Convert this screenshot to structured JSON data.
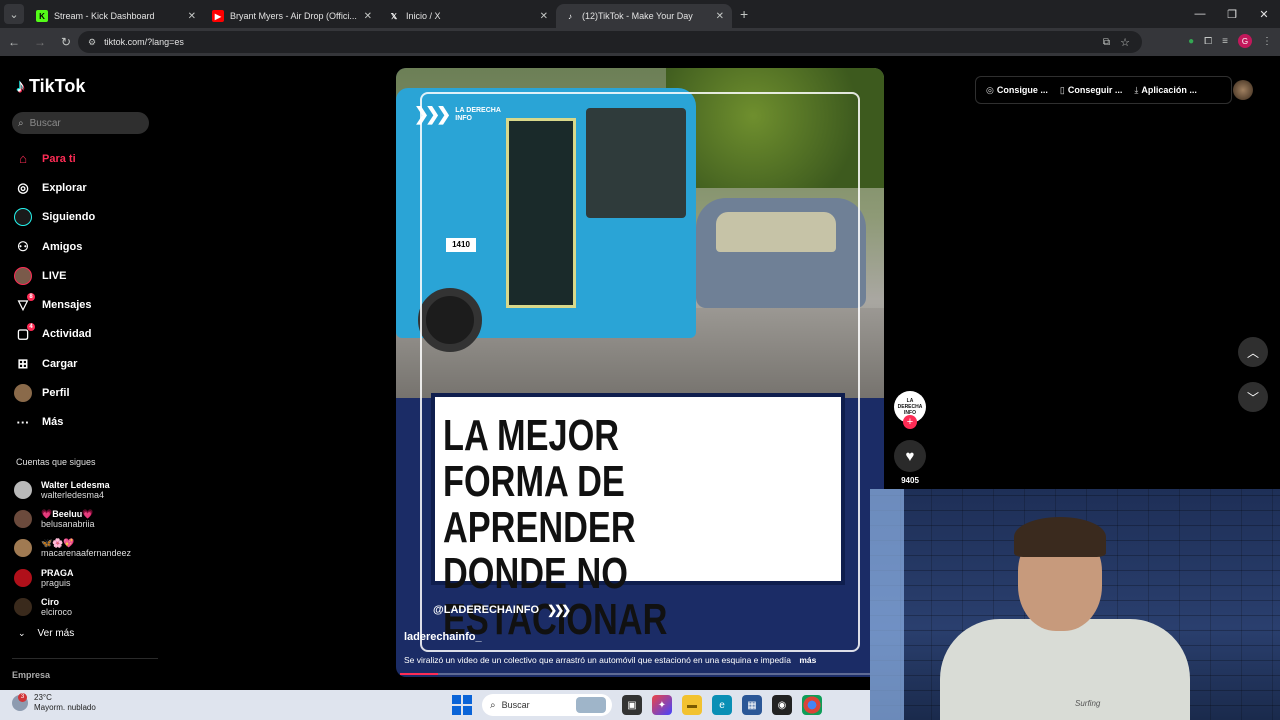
{
  "browser": {
    "tabs": [
      {
        "title": "Stream - Kick Dashboard",
        "icon": "kick-icon",
        "active": false
      },
      {
        "title": "Bryant Myers - Air Drop (Offici...",
        "icon": "youtube-icon",
        "active": false
      },
      {
        "title": "Inicio / X",
        "icon": "x-icon",
        "active": false
      },
      {
        "title": "(12)TikTok - Make Your Day",
        "icon": "tiktok-icon",
        "active": true
      }
    ],
    "url": "tiktok.com/?lang=es",
    "profile_initial": "G"
  },
  "sidebar": {
    "logo_text": "TikTok",
    "search_placeholder": "Buscar",
    "nav": [
      {
        "label": "Para ti",
        "icon": "home-icon",
        "active": true
      },
      {
        "label": "Explorar",
        "icon": "compass-icon"
      },
      {
        "label": "Siguiendo",
        "icon": "following-avatar-icon"
      },
      {
        "label": "Amigos",
        "icon": "friends-icon"
      },
      {
        "label": "LIVE",
        "icon": "live-avatar-icon"
      },
      {
        "label": "Mensajes",
        "icon": "messages-icon",
        "badge": "8"
      },
      {
        "label": "Actividad",
        "icon": "activity-icon",
        "badge": "4"
      },
      {
        "label": "Cargar",
        "icon": "upload-icon"
      },
      {
        "label": "Perfil",
        "icon": "profile-icon"
      },
      {
        "label": "Más",
        "icon": "more-icon"
      }
    ],
    "following_title": "Cuentas que sigues",
    "following": [
      {
        "name": "Walter Ledesma",
        "handle": "walterledesma4",
        "color": "#b9b9b9"
      },
      {
        "name": "💗Beeluu💗",
        "handle": "belusanabriia",
        "color": "#6b4a3c"
      },
      {
        "name": "🦋🌸💖",
        "handle": "macarenaafernandeez",
        "color": "#a07a52"
      },
      {
        "name": "PRAGA",
        "handle": "praguis",
        "color": "#b0101a"
      },
      {
        "name": "Ciro",
        "handle": "elciroco",
        "color": "#3a2a1c"
      }
    ],
    "see_more": "Ver más",
    "footer": "Empresa"
  },
  "video": {
    "brand_text": "LA DERECHA INFO",
    "headline": "LA MEJOR FORMA DE\nAPRENDER DONDE NO\nESTACIONAR",
    "handle_overlay": "@LADERECHAINFO",
    "bus_number": "1410",
    "author": "laderechainfo_",
    "caption": "Se viralizó un video de un colectivo que arrastró un automóvil que estacionó en una esquina e impedía",
    "caption_more": "más",
    "progress": 0.08
  },
  "actions": {
    "creator_label": "LA DERECHA INFO",
    "like_count": "9405"
  },
  "top_actions": [
    {
      "label": "Consigue ...",
      "icon": "coin-icon"
    },
    {
      "label": "Conseguir ...",
      "icon": "phone-icon"
    },
    {
      "label": "Aplicación ...",
      "icon": "download-icon"
    }
  ],
  "webcam": {
    "shirt_text": "Surfing"
  },
  "taskbar": {
    "weather_temp": "23°C",
    "weather_desc": "Mayorm. nublado",
    "weather_badge": "3",
    "search_label": "Buscar"
  },
  "colors": {
    "accent": "#fe2c55",
    "video_bg": "#1b2c66"
  }
}
